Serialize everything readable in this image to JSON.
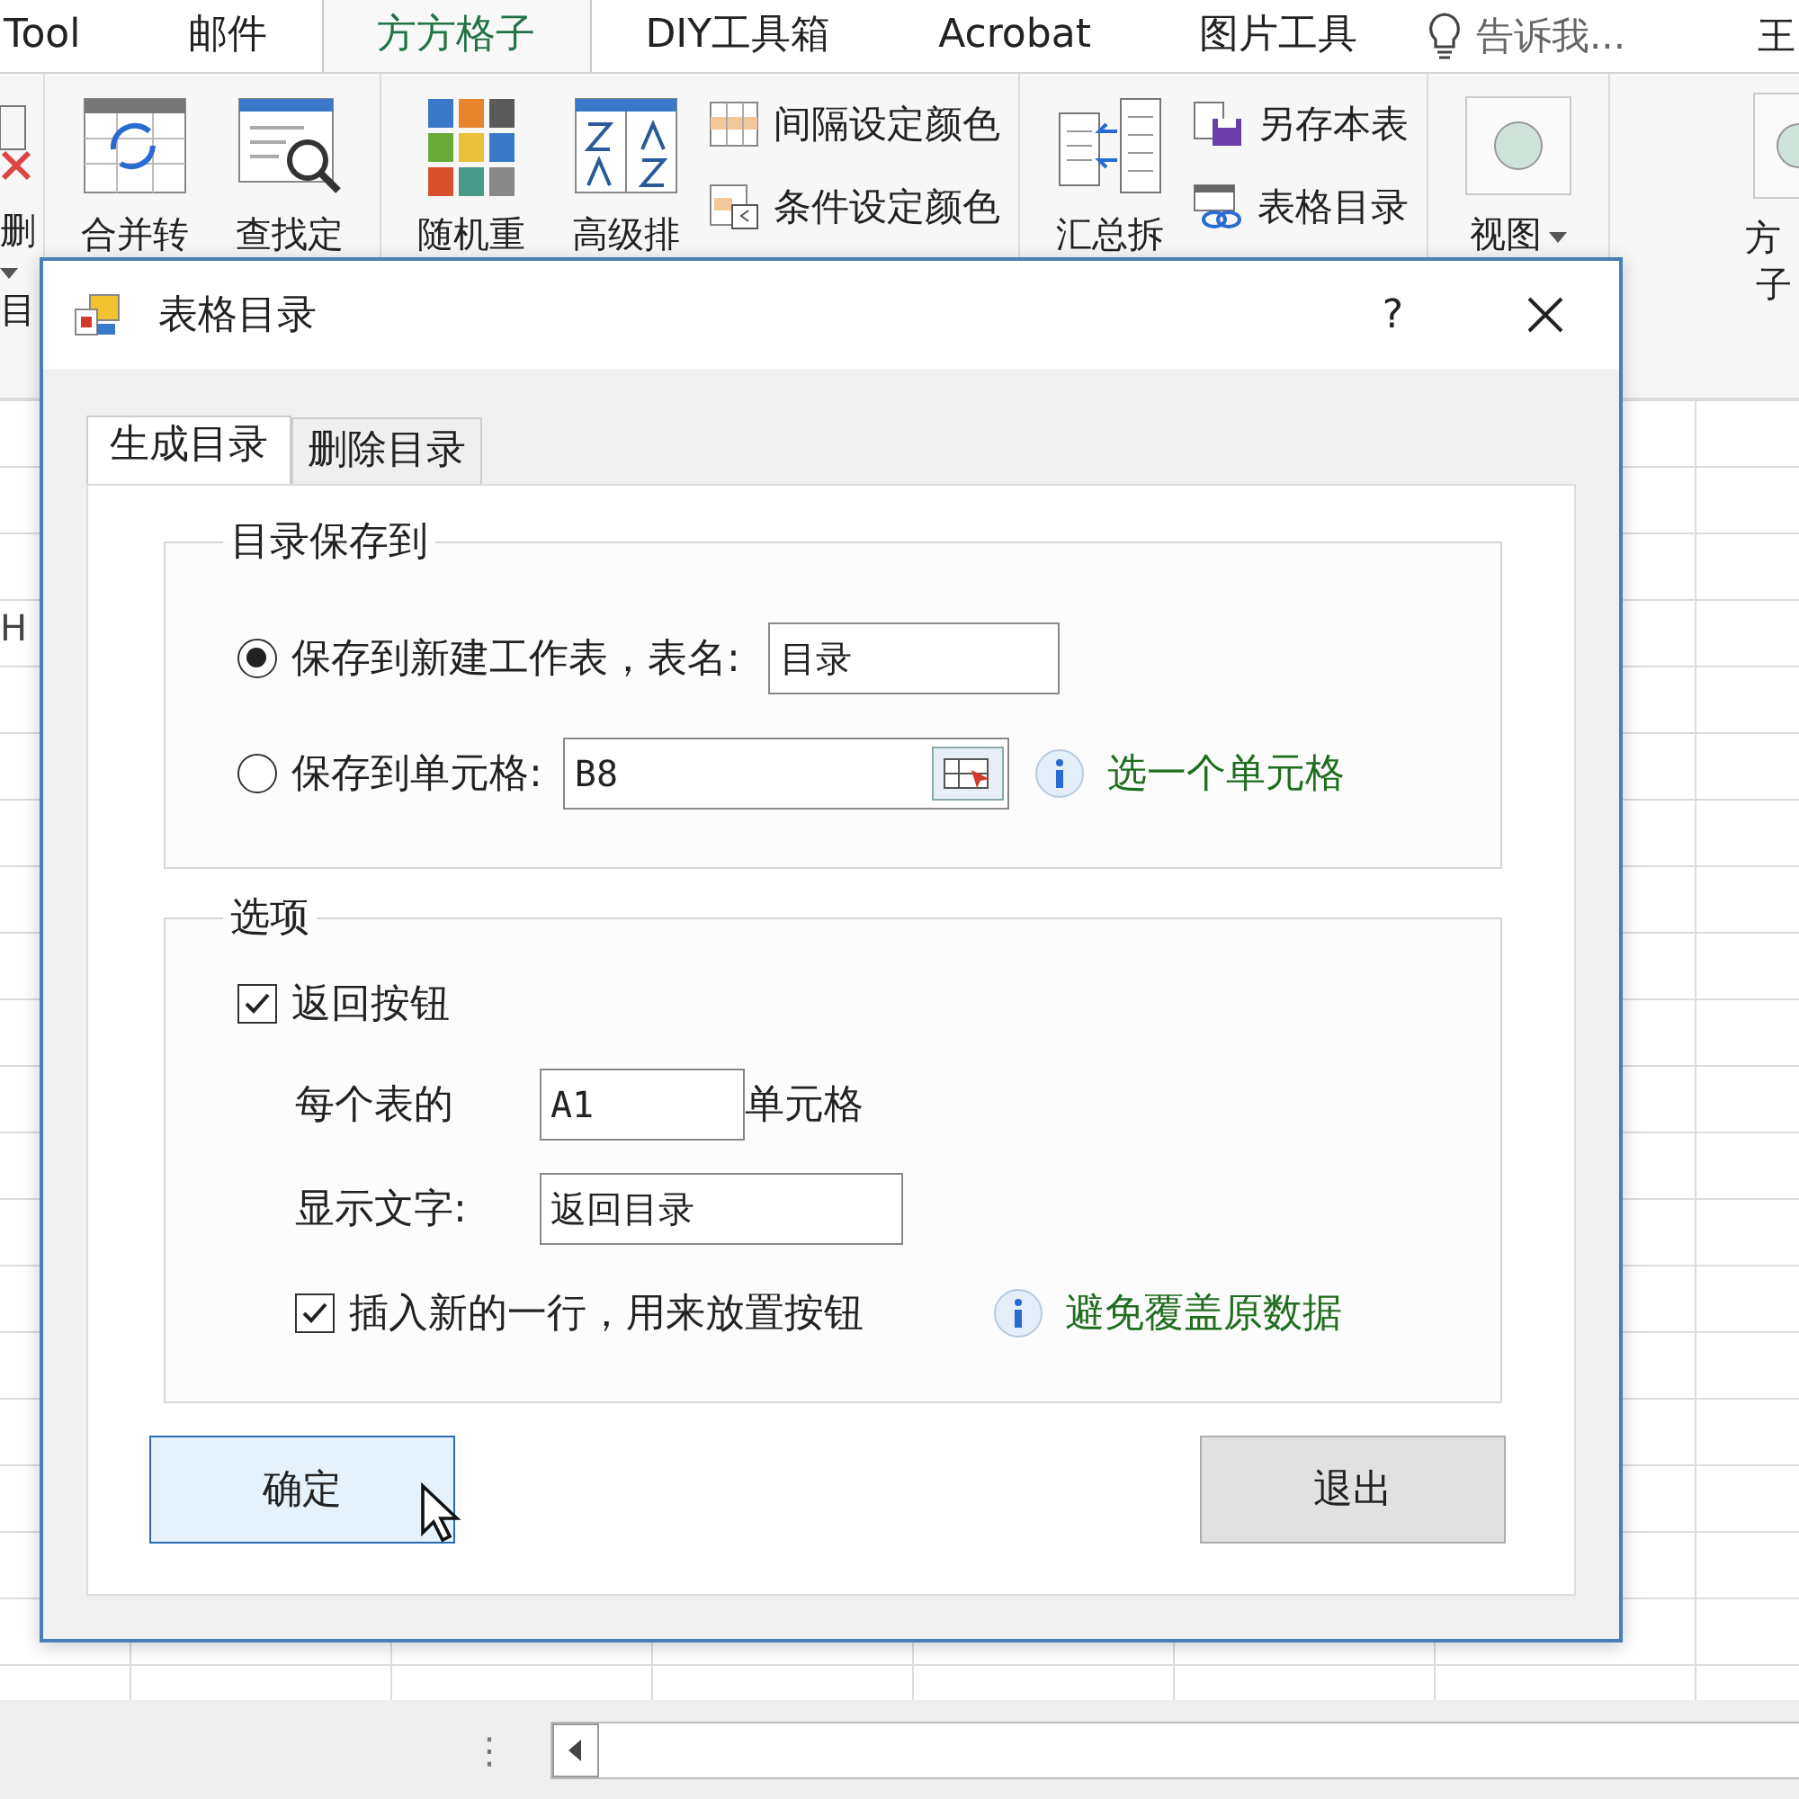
{
  "ribbon_tabs": [
    {
      "label": "Tool",
      "selected": false
    },
    {
      "label": "邮件",
      "selected": false
    },
    {
      "label": "方方格子",
      "selected": true
    },
    {
      "label": "DIY工具箱",
      "selected": false
    },
    {
      "label": "Acrobat",
      "selected": false
    },
    {
      "label": "图片工具",
      "selected": false
    }
  ],
  "tell_me": "告诉我...",
  "account_initial": "王",
  "ribbon": {
    "left_fragment": {
      "label": "删",
      "sub": "目"
    },
    "groups": [
      {
        "large": [
          {
            "kind": "merge",
            "label": "合并转"
          },
          {
            "kind": "find",
            "label": "查找定"
          }
        ]
      },
      {
        "large": [
          {
            "kind": "random",
            "label": "随机重"
          },
          {
            "kind": "sort",
            "label": "高级排"
          }
        ],
        "small": [
          {
            "kind": "stripes",
            "label": "间隔设定颜色"
          },
          {
            "kind": "condition",
            "label": "条件设定颜色"
          }
        ]
      },
      {
        "large": [
          {
            "kind": "summary",
            "label": "汇总拆"
          }
        ],
        "small": [
          {
            "kind": "save",
            "label": "另存本表"
          },
          {
            "kind": "toc",
            "label": "表格目录"
          }
        ]
      },
      {
        "large": [
          {
            "kind": "view",
            "label": "视图"
          }
        ]
      }
    ],
    "right_fragment": {
      "label": "方",
      "sub": "子"
    }
  },
  "row_header": "H",
  "dialog": {
    "title": "表格目录",
    "help": "?",
    "tabs": [
      {
        "label": "生成目录",
        "selected": true
      },
      {
        "label": "删除目录",
        "selected": false
      }
    ],
    "save_group": {
      "title": "目录保存到",
      "options": [
        {
          "label": "保存到新建工作表，表名:",
          "selected": true,
          "value": "目录"
        },
        {
          "label": "保存到单元格:",
          "selected": false,
          "value": "B8",
          "picker": true,
          "hint": "选一个单元格"
        }
      ]
    },
    "options_group": {
      "title": "选项",
      "back_button": {
        "label": "返回按钮",
        "checked": true
      },
      "cell_prefix": "每个表的",
      "cell_value": "A1",
      "cell_suffix": "单元格",
      "text_label": "显示文字:",
      "text_value": "返回目录",
      "insert_row": {
        "label": "插入新的一行，用来放置按钮",
        "checked": true
      },
      "hint": "避免覆盖原数据"
    },
    "buttons": [
      {
        "label": "确定",
        "highlighted": true
      },
      {
        "label": "退出",
        "highlighted": false
      }
    ]
  },
  "sheet_bar": {
    "menu": "⋮"
  }
}
